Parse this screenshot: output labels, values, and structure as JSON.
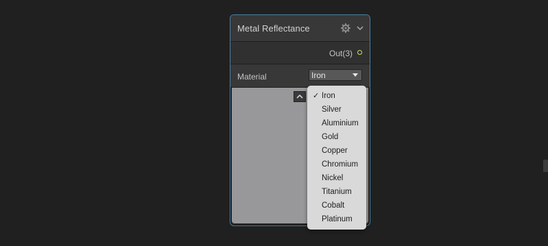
{
  "node": {
    "title": "Metal Reflectance",
    "output_label": "Out(3)",
    "material_label": "Material",
    "material_selected": "Iron"
  },
  "icons": {
    "settings": "gear-icon",
    "collapse": "chevron-down-icon",
    "dropdown": "triangle-down-icon",
    "preview_toggle": "chevron-up-icon",
    "checkmark": "checkmark-icon"
  },
  "checkmark_glyph": "✓",
  "dropdown_options": [
    "Iron",
    "Silver",
    "Aluminium",
    "Gold",
    "Copper",
    "Chromium",
    "Nickel",
    "Titanium",
    "Cobalt",
    "Platinum"
  ],
  "colors": {
    "background": "#202020",
    "node_border": "#4b7fa0",
    "output_port": "#d6dc6a",
    "preview": "#98989a",
    "menu_background": "#d9d9d9"
  }
}
